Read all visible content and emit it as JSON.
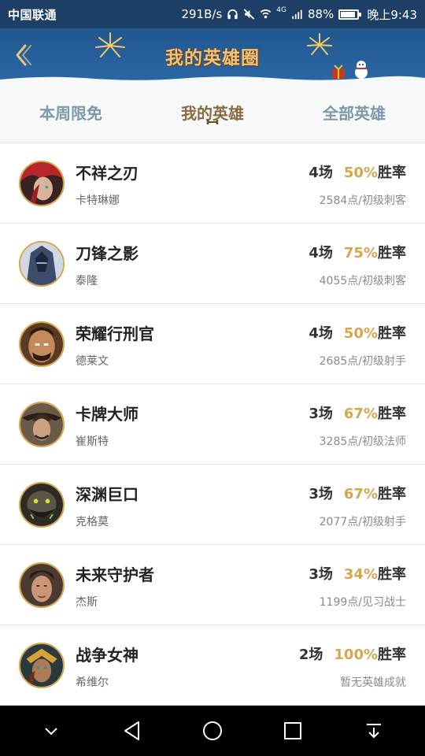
{
  "status_bar": {
    "carrier": "中国联通",
    "speed": "291B/s",
    "network": "4G",
    "battery": "88%",
    "time": "晚上9:43"
  },
  "header": {
    "title": "我的英雄圈",
    "back_icon": "chevron-left-icon"
  },
  "tabs": [
    {
      "label": "本周限免",
      "active": false
    },
    {
      "label": "我的英雄",
      "active": true
    },
    {
      "label": "全部英雄",
      "active": false
    }
  ],
  "colors": {
    "header_bg": "#22578f",
    "title_gold": "#f0c37a",
    "winrate_gold": "#d6a64f",
    "tab_active": "#8a6a3f",
    "tab_inactive": "#7c9aa8"
  },
  "heroes": [
    {
      "name": "不祥之刃",
      "champion": "卡特琳娜",
      "games": "4场",
      "winrate": "50%",
      "winrate_label": "胜率",
      "rank": "2584点/初级刺客"
    },
    {
      "name": "刀锋之影",
      "champion": "泰隆",
      "games": "4场",
      "winrate": "75%",
      "winrate_label": "胜率",
      "rank": "4055点/初级刺客"
    },
    {
      "name": "荣耀行刑官",
      "champion": "德莱文",
      "games": "4场",
      "winrate": "50%",
      "winrate_label": "胜率",
      "rank": "2685点/初级射手"
    },
    {
      "name": "卡牌大师",
      "champion": "崔斯特",
      "games": "3场",
      "winrate": "67%",
      "winrate_label": "胜率",
      "rank": "3285点/初级法师"
    },
    {
      "name": "深渊巨口",
      "champion": "克格莫",
      "games": "3场",
      "winrate": "67%",
      "winrate_label": "胜率",
      "rank": "2077点/初级射手"
    },
    {
      "name": "未来守护者",
      "champion": "杰斯",
      "games": "3场",
      "winrate": "34%",
      "winrate_label": "胜率",
      "rank": "1199点/见习战士"
    },
    {
      "name": "战争女神",
      "champion": "希维尔",
      "games": "2场",
      "winrate": "100%",
      "winrate_label": "胜率",
      "rank": "暂无英雄成就"
    }
  ],
  "nav": {
    "icons": [
      "chevron-down-icon",
      "back-triangle-icon",
      "home-circle-icon",
      "recents-square-icon",
      "notification-pull-icon"
    ]
  }
}
